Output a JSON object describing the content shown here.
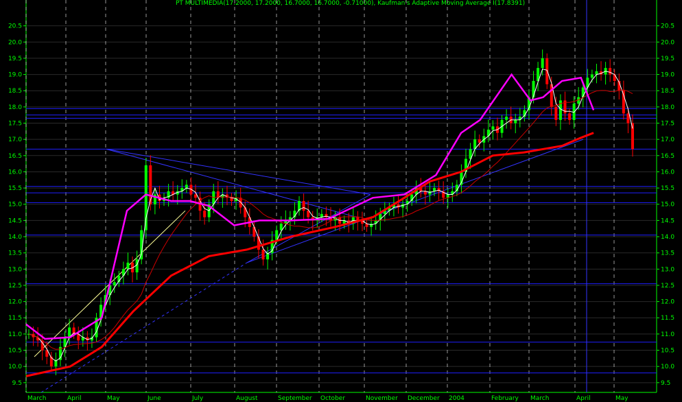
{
  "title": "PT MULTIMEDIA(17.2000, 17.2000, 16.7000, 16.7000, -0.71000), Kaufman's Adaptive Moving Average I(17.8391)",
  "chart_data": {
    "type": "candlestick",
    "ylim": [
      9.2,
      21.0
    ],
    "y_ticks": [
      9.5,
      10.0,
      10.5,
      11.0,
      11.5,
      12.0,
      12.5,
      13.0,
      13.5,
      14.0,
      14.5,
      15.0,
      15.5,
      16.0,
      16.5,
      17.0,
      17.5,
      18.0,
      18.5,
      19.0,
      19.5,
      20.0,
      20.5
    ],
    "x_labels": [
      "March",
      "April",
      "May",
      "June",
      "July",
      "August",
      "September",
      "October",
      "November",
      "December",
      "2004",
      "February",
      "March",
      "April",
      "May"
    ],
    "grid": true,
    "horizontal_lines": [
      9.8,
      10.75,
      12.55,
      14.05,
      15.05,
      15.35,
      15.55,
      16.7,
      17.65,
      17.75,
      17.95
    ],
    "series": [
      {
        "name": "PT MULTIMEDIA",
        "type": "candlestick",
        "closes": [
          11.0,
          10.9,
          10.8,
          10.5,
          10.3,
          10.0,
          10.2,
          10.6,
          10.9,
          11.2,
          11.0,
          10.8,
          10.9,
          10.8,
          10.9,
          11.5,
          11.9,
          12.2,
          12.5,
          12.6,
          12.8,
          13.0,
          13.2,
          12.9,
          13.3,
          14.2,
          16.2,
          15.0,
          15.3,
          15.1,
          15.2,
          15.4,
          15.3,
          15.4,
          15.5,
          15.6,
          15.3,
          15.2,
          14.8,
          14.6,
          15.0,
          15.4,
          15.2,
          15.3,
          15.2,
          15.1,
          15.2,
          14.9,
          14.6,
          14.3,
          14.0,
          13.6,
          13.3,
          13.5,
          13.9,
          14.2,
          14.4,
          14.5,
          14.6,
          14.8,
          15.1,
          14.8,
          14.6,
          14.5,
          14.6,
          14.7,
          14.6,
          14.5,
          14.6,
          14.4,
          14.5,
          14.4,
          14.6,
          14.5,
          14.4,
          14.3,
          14.4,
          14.5,
          14.7,
          14.8,
          14.9,
          15.0,
          14.9,
          15.0,
          15.1,
          15.3,
          15.5,
          15.4,
          15.3,
          15.4,
          15.5,
          15.4,
          15.2,
          15.3,
          15.4,
          15.6,
          16.0,
          16.4,
          16.7,
          17.0,
          16.9,
          17.1,
          17.3,
          17.4,
          17.2,
          17.6,
          17.7,
          17.5,
          17.6,
          17.7,
          17.9,
          18.3,
          18.8,
          19.2,
          19.5,
          18.7,
          18.0,
          17.6,
          18.2,
          17.8,
          17.6,
          18.1,
          18.3,
          18.6,
          18.9,
          19.0,
          19.1,
          19.0,
          19.2,
          19.0,
          18.8,
          18.5,
          17.8,
          17.5,
          16.7
        ]
      },
      {
        "name": "",
        "type": "line",
        "color": "#ff00ff",
        "points": [
          [
            11.3,
            0
          ],
          [
            10.85,
            0.03
          ],
          [
            10.9,
            0.07
          ],
          [
            11.5,
            0.12
          ],
          [
            14.8,
            0.16
          ],
          [
            15.3,
            0.19
          ],
          [
            15.1,
            0.23
          ],
          [
            15.1,
            0.26
          ],
          [
            14.95,
            0.29
          ],
          [
            14.35,
            0.33
          ],
          [
            14.5,
            0.37
          ],
          [
            14.5,
            0.42
          ],
          [
            14.55,
            0.48
          ],
          [
            15.2,
            0.55
          ],
          [
            15.3,
            0.6
          ],
          [
            15.9,
            0.65
          ],
          [
            17.2,
            0.69
          ],
          [
            17.6,
            0.72
          ],
          [
            19.0,
            0.77
          ],
          [
            18.2,
            0.8
          ],
          [
            18.3,
            0.82
          ],
          [
            18.8,
            0.85
          ],
          [
            18.9,
            0.88
          ],
          [
            17.9,
            0.9
          ]
        ]
      },
      {
        "name": "",
        "type": "line",
        "color": "#ff0000",
        "points": [
          [
            9.7,
            0
          ],
          [
            10.0,
            0.07
          ],
          [
            10.6,
            0.12
          ],
          [
            11.7,
            0.17
          ],
          [
            12.8,
            0.23
          ],
          [
            13.4,
            0.29
          ],
          [
            13.6,
            0.35
          ],
          [
            14.0,
            0.42
          ],
          [
            14.3,
            0.49
          ],
          [
            14.6,
            0.55
          ],
          [
            15.2,
            0.6
          ],
          [
            15.7,
            0.64
          ],
          [
            16.0,
            0.69
          ],
          [
            16.5,
            0.74
          ],
          [
            16.6,
            0.79
          ],
          [
            16.8,
            0.85
          ],
          [
            17.05,
            0.88
          ],
          [
            17.2,
            0.9
          ]
        ]
      }
    ]
  }
}
